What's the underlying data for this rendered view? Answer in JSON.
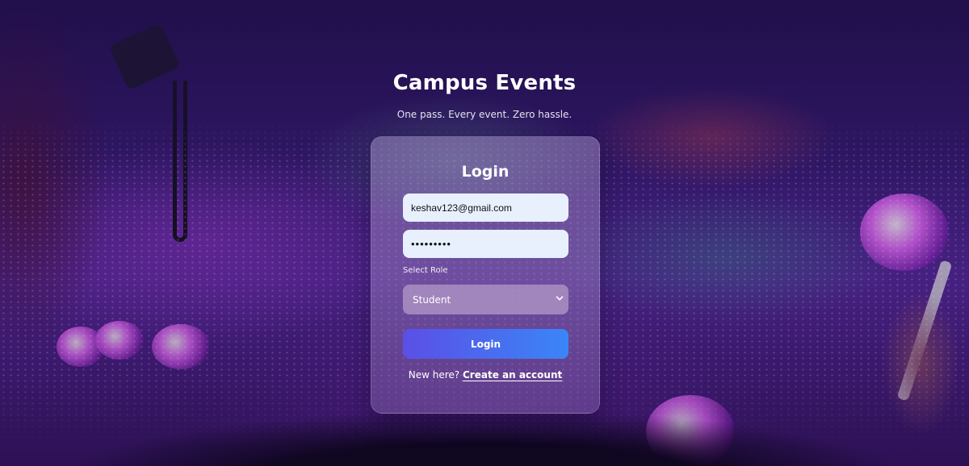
{
  "hero": {
    "title": "Campus Events",
    "subtitle": "One pass. Every event. Zero hassle."
  },
  "login_card": {
    "title": "Login",
    "email_value": "keshav123@gmail.com",
    "password_masked": "•••••••••",
    "role_label": "Select Role",
    "role_selected": "Student",
    "submit_label": "Login",
    "signup_prompt": "New here?",
    "signup_link": "Create an account"
  },
  "colors": {
    "button_gradient_start": "#5b4fe6",
    "button_gradient_end": "#3a86f7",
    "input_background": "#e8f0fe"
  },
  "icons": {
    "select_arrow": "chevron-down-icon"
  }
}
